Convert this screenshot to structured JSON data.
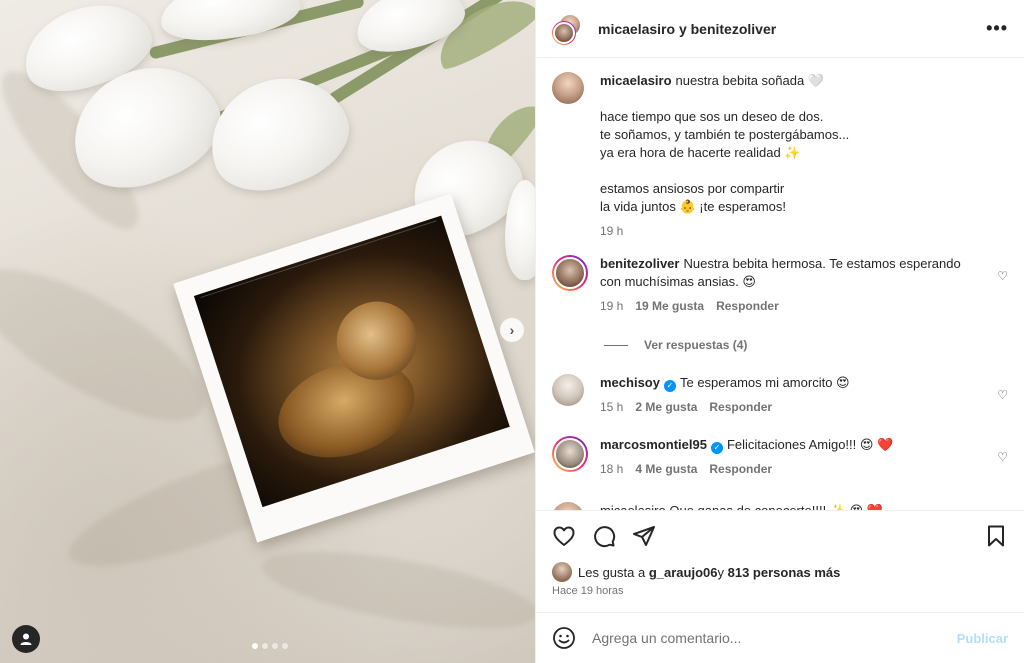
{
  "header": {
    "authors": "micaelasiro y benitezoliver",
    "more_icon": "more-horizontal-icon"
  },
  "caption": {
    "username": "micaelasiro",
    "first_line": "nuestra bebita soñada 🤍",
    "lines_block1": [
      "hace tiempo que sos un deseo de dos.",
      "te soñamos, y también te postergábamos...",
      "ya era hora de hacerte realidad ✨"
    ],
    "lines_block2": [
      "estamos ansiosos por compartir",
      "la vida juntos 👶 ¡te esperamos!"
    ],
    "time": "19 h"
  },
  "comments": [
    {
      "username": "benitezoliver",
      "text": "Nuestra bebita hermosa. Te estamos esperando con muchísimas ansias. 😍",
      "time": "19 h",
      "likes": "19 Me gusta",
      "reply": "Responder",
      "verified": false
    },
    {
      "username": "mechisoy",
      "text": "Te esperamos mi amorcito 😍",
      "time": "15 h",
      "likes": "2 Me gusta",
      "reply": "Responder",
      "verified": true
    },
    {
      "username": "marcosmontiel95",
      "text": "Felicitaciones Amigo!!! 😍 ❤️",
      "time": "18 h",
      "likes": "4 Me gusta",
      "reply": "Responder",
      "verified": true
    }
  ],
  "partial_comment": "micaelasiro Que ganas de conocerte!!!! ✨ 😍 ❤️",
  "view_replies": "Ver respuestas (4)",
  "likes": {
    "prefix": "Les gusta a ",
    "user": "g_araujo06",
    "middle": " y ",
    "count": "813 personas más"
  },
  "time_ago": "Hace 19 horas",
  "add_comment": {
    "placeholder": "Agrega un comentario...",
    "publish": "Publicar"
  },
  "colors": {
    "verified": "#0095f6",
    "publish_disabled": "#b2dffc",
    "secondary_text": "#737373"
  }
}
